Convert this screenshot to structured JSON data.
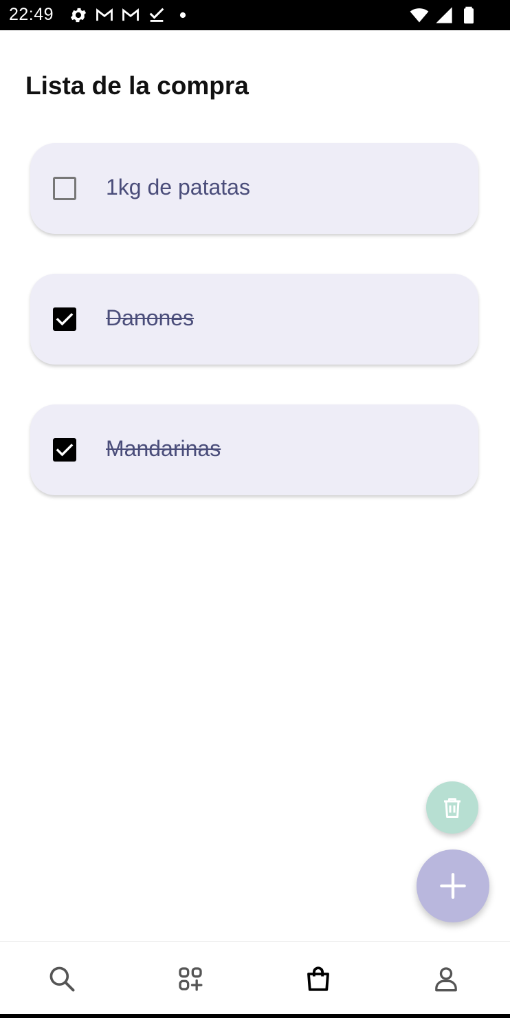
{
  "status_bar": {
    "time": "22:49",
    "left_icons": [
      "gear-icon",
      "gmail-icon",
      "gmail-icon",
      "download-done-icon",
      "dot-icon"
    ],
    "right_icons": [
      "wifi-icon",
      "signal-icon",
      "battery-icon"
    ]
  },
  "page": {
    "title": "Lista de la compra"
  },
  "items": [
    {
      "label": "1kg de patatas",
      "checked": false
    },
    {
      "label": "Danones",
      "checked": true
    },
    {
      "label": "Mandarinas",
      "checked": true
    }
  ],
  "fabs": {
    "delete_icon": "trash-icon",
    "add_icon": "plus-icon"
  },
  "bottom_nav": {
    "items": [
      {
        "icon": "search-icon",
        "active": false
      },
      {
        "icon": "categories-icon",
        "active": false
      },
      {
        "icon": "shopping-bag-icon",
        "active": true
      },
      {
        "icon": "profile-icon",
        "active": false
      }
    ]
  },
  "colors": {
    "card_background": "#eeedf7",
    "item_text": "#4a4d7a",
    "fab_delete": "#b7dfd2",
    "fab_add": "#b9b7dd"
  }
}
